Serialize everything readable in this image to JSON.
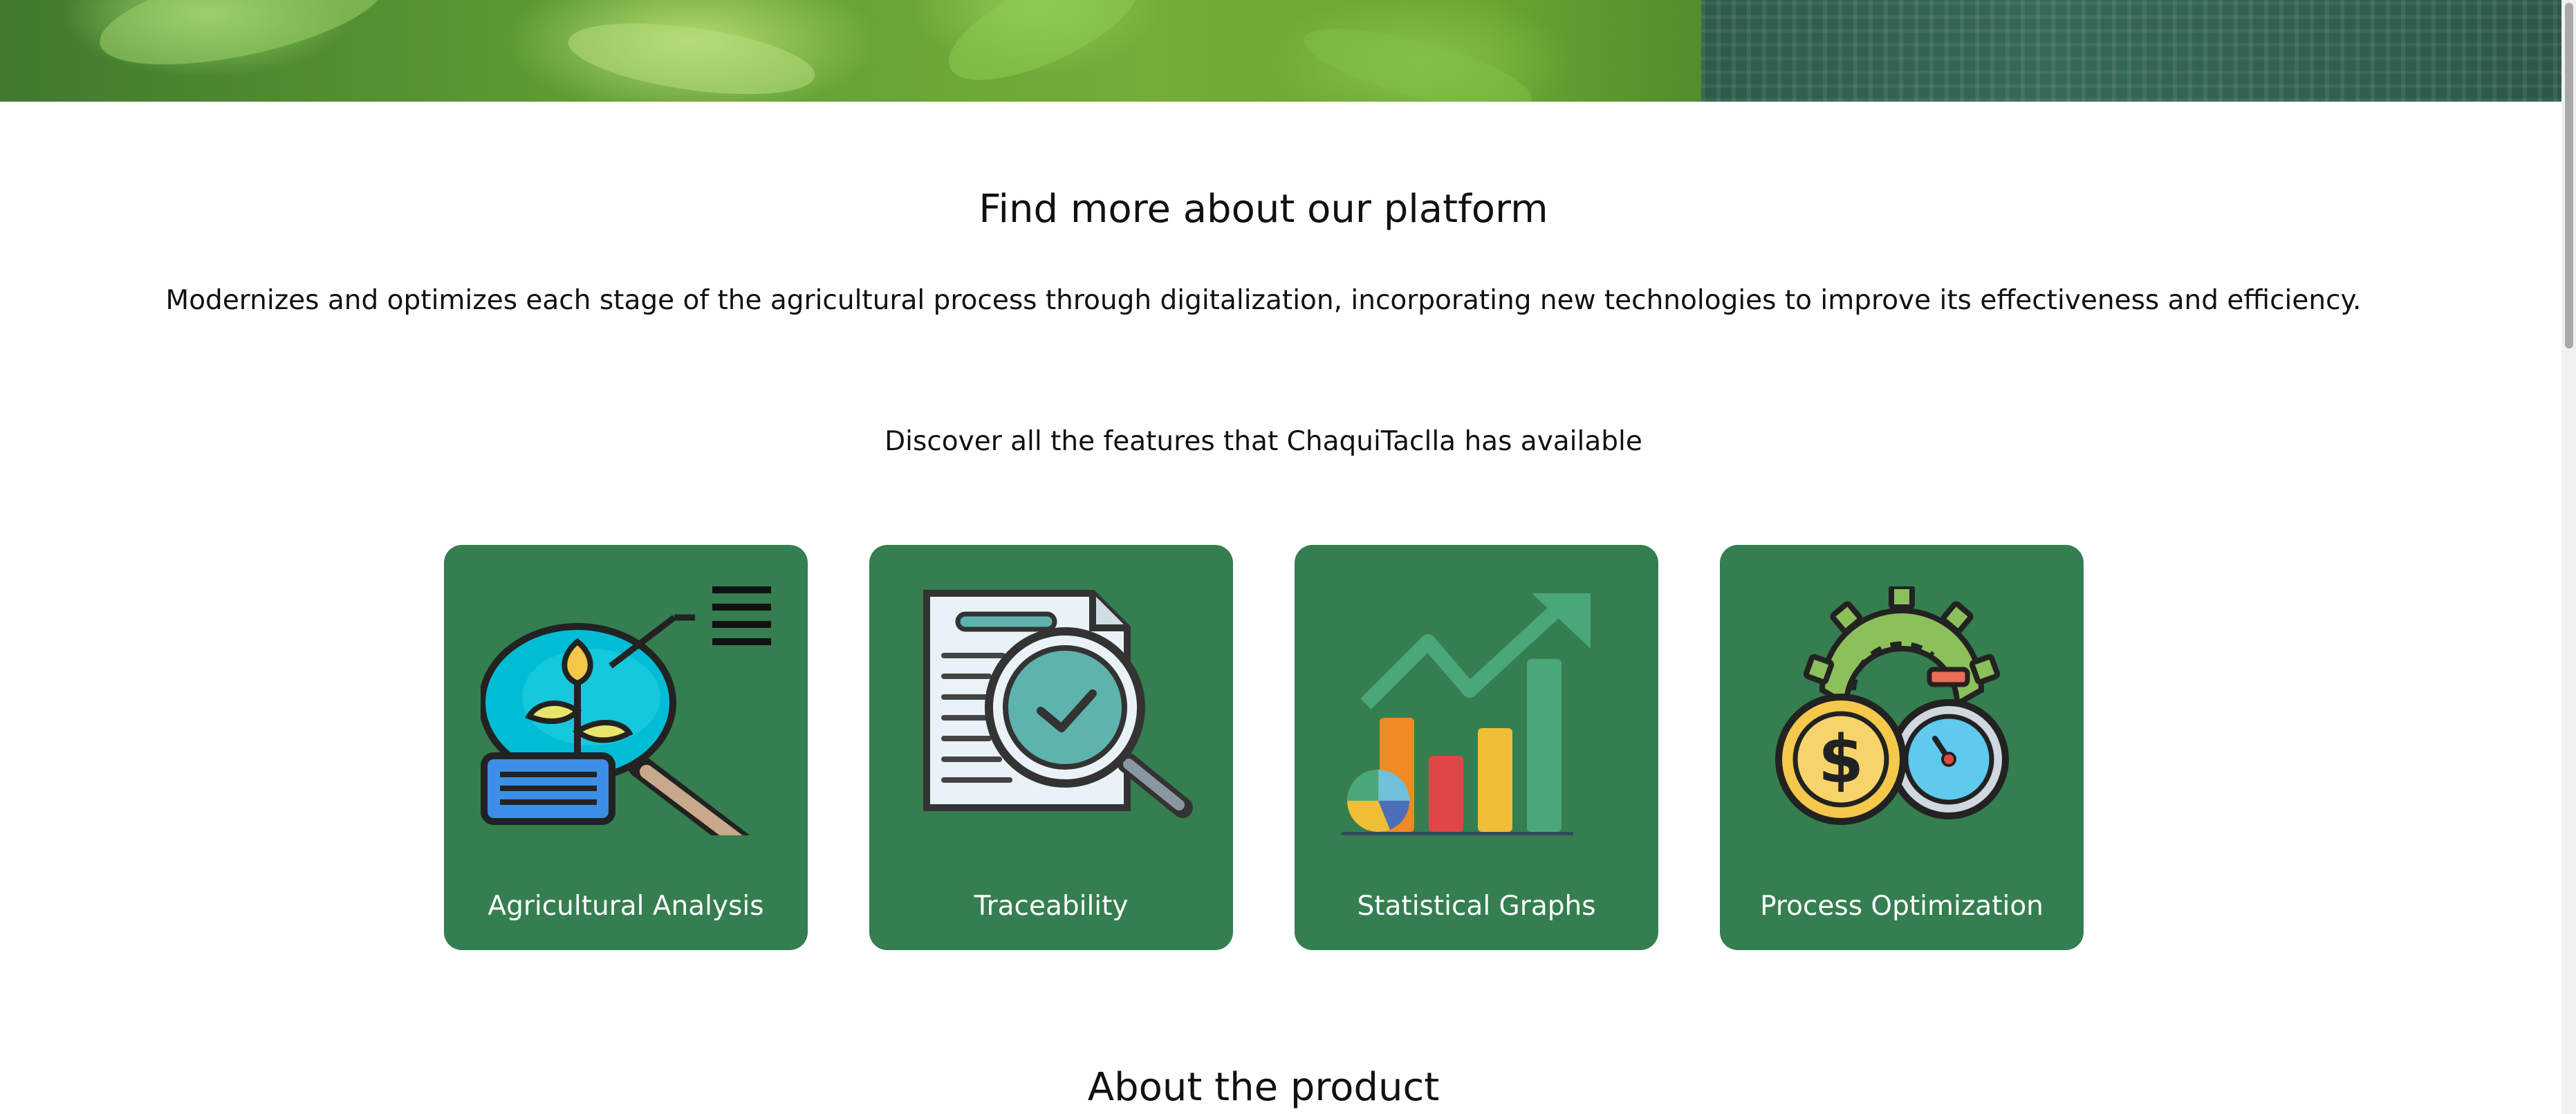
{
  "hero": {
    "image": "crop-leaves-banner"
  },
  "section": {
    "title": "Find more about our platform",
    "description": "Modernizes and optimizes each stage of the agricultural process through digitalization, incorporating new technologies to improve its effectiveness and efficiency.",
    "features_heading": "Discover all the features that ChaquiTaclla has available"
  },
  "features": [
    {
      "label": "Agricultural Analysis",
      "icon": "plant-magnifier-icon"
    },
    {
      "label": "Traceability",
      "icon": "document-search-icon"
    },
    {
      "label": "Statistical Graphs",
      "icon": "bar-chart-growth-icon"
    },
    {
      "label": "Process Optimization",
      "icon": "coin-stopwatch-icon"
    }
  ],
  "next_section": {
    "title": "About the product"
  },
  "colors": {
    "card_bg": "#357e50",
    "text": "#111111",
    "card_text": "#ffffff"
  }
}
